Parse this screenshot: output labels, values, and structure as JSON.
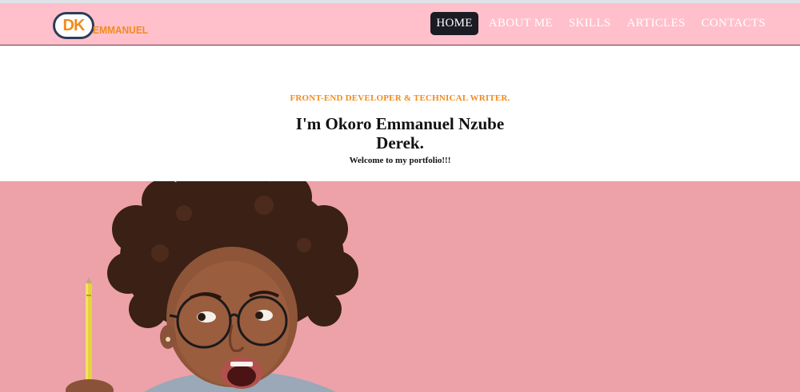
{
  "logo": {
    "mark": "DK",
    "name": "EMMANUEL"
  },
  "nav": {
    "items": [
      {
        "label": "HOME",
        "active": true
      },
      {
        "label": "ABOUT ME",
        "active": false
      },
      {
        "label": "SKILLS",
        "active": false
      },
      {
        "label": "ARTICLES",
        "active": false
      },
      {
        "label": "CONTACTS",
        "active": false
      }
    ]
  },
  "hero": {
    "role": "FRONT-END DEVELOPER & TECHNICAL WRITER.",
    "name": "I'm Okoro Emmanuel Nzube Derek.",
    "welcome": "Welcome to my portfolio!!!"
  },
  "colors": {
    "navbar": "#ffc0cb",
    "accent": "#f28b1c",
    "hero_background": "#eca2a8",
    "active_nav": "#1b1b24"
  }
}
